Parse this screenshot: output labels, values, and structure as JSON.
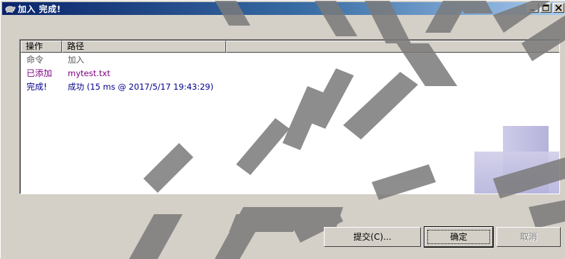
{
  "window": {
    "title": "加入 完成!",
    "icon": "tortoise-icon"
  },
  "titlebar_buttons": [
    "minimize-icon",
    "maximize-icon",
    "close-icon"
  ],
  "list": {
    "columns": [
      "操作",
      "路径"
    ],
    "rows": [
      {
        "op": "命令",
        "path": "加入",
        "color": "#555555"
      },
      {
        "op": "已添加",
        "path": "mytest.txt",
        "color": "#800080"
      },
      {
        "op": "完成!",
        "path": "成功 (15 ms @ 2017/5/17 19:43:29)",
        "color": "#00008b"
      }
    ]
  },
  "buttons": {
    "submit": "提交(C)...",
    "ok": "确定",
    "cancel": "取消"
  },
  "colors": {
    "titlebar_start": "#0a246a",
    "titlebar_end": "#a6caf0",
    "dialog_bg": "#d4d0c8",
    "added_text": "#800080",
    "done_text": "#00008b"
  }
}
